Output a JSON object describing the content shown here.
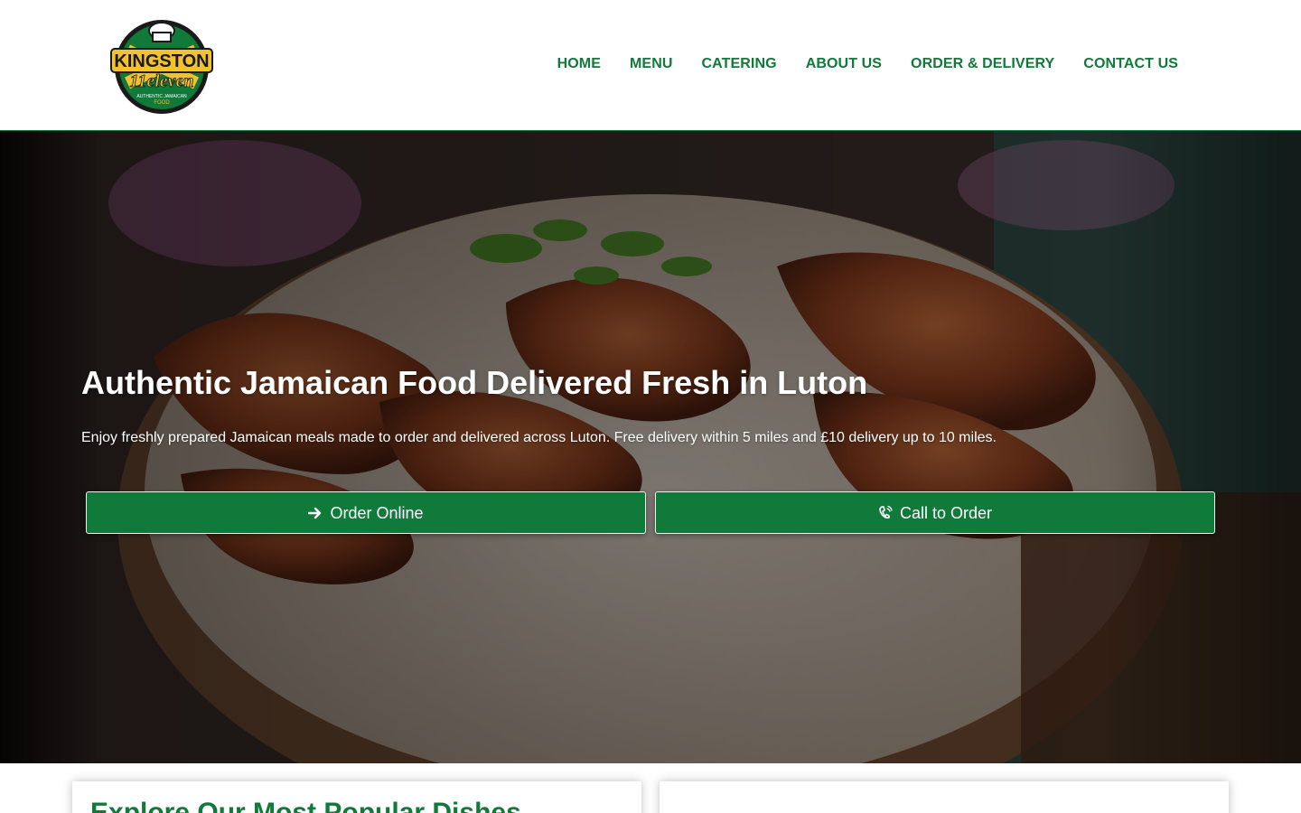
{
  "brand": {
    "logo_line1": "KINGSTON",
    "logo_line2": "11eleven",
    "logo_tagline_1": "AUTHENTIC JAMAICAN",
    "logo_tagline_2": "FOOD",
    "colors": {
      "green": "#0f7a3a",
      "gold": "#f2c230",
      "dark": "#1a1a1a"
    }
  },
  "nav": {
    "items": [
      {
        "label": "HOME"
      },
      {
        "label": "MENU"
      },
      {
        "label": "CATERING"
      },
      {
        "label": "ABOUT US"
      },
      {
        "label": "ORDER & DELIVERY"
      },
      {
        "label": "CONTACT US"
      }
    ]
  },
  "hero": {
    "title": "Authentic Jamaican Food Delivered Fresh in Luton",
    "subtitle": "Enjoy freshly prepared Jamaican meals made to order and delivered across Luton. Free delivery within 5 miles and £10 delivery up to 10 miles.",
    "buttons": [
      {
        "label": "Order Online",
        "icon": "arrow-right-icon"
      },
      {
        "label": "Call to Order",
        "icon": "phone-volume-icon"
      }
    ]
  },
  "sections": {
    "popular_title": "Explore Our Most Popular Dishes"
  }
}
